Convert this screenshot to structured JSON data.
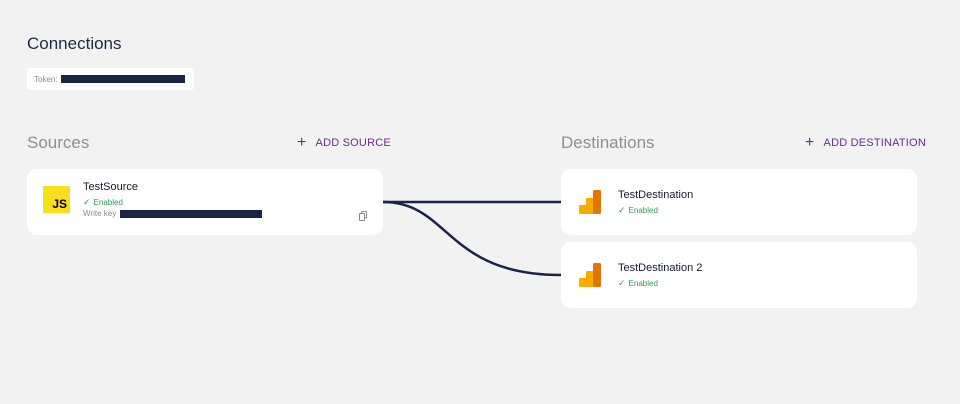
{
  "header": {
    "title": "Connections",
    "token_label": "Token:"
  },
  "sources": {
    "title": "Sources",
    "add_label": "ADD SOURCE",
    "items": [
      {
        "name": "TestSource",
        "status": "Enabled",
        "write_key_label": "Write key",
        "icon": "javascript-logo"
      }
    ]
  },
  "destinations": {
    "title": "Destinations",
    "add_label": "ADD DESTINATION",
    "items": [
      {
        "name": "TestDestination",
        "status": "Enabled",
        "icon": "google-analytics-logo"
      },
      {
        "name": "TestDestination 2",
        "status": "Enabled",
        "icon": "google-analytics-logo"
      }
    ]
  },
  "icons": {
    "add": "+",
    "check": "✓",
    "copy": "copy-icon"
  },
  "colors": {
    "background": "#f2f2f2",
    "accent": "#6a2c91",
    "enabled": "#2e9a52",
    "connector": "#1b2347",
    "js_yellow": "#f7df1e",
    "ga_orange": "#f9ab00",
    "ga_dark_orange": "#e37400"
  }
}
